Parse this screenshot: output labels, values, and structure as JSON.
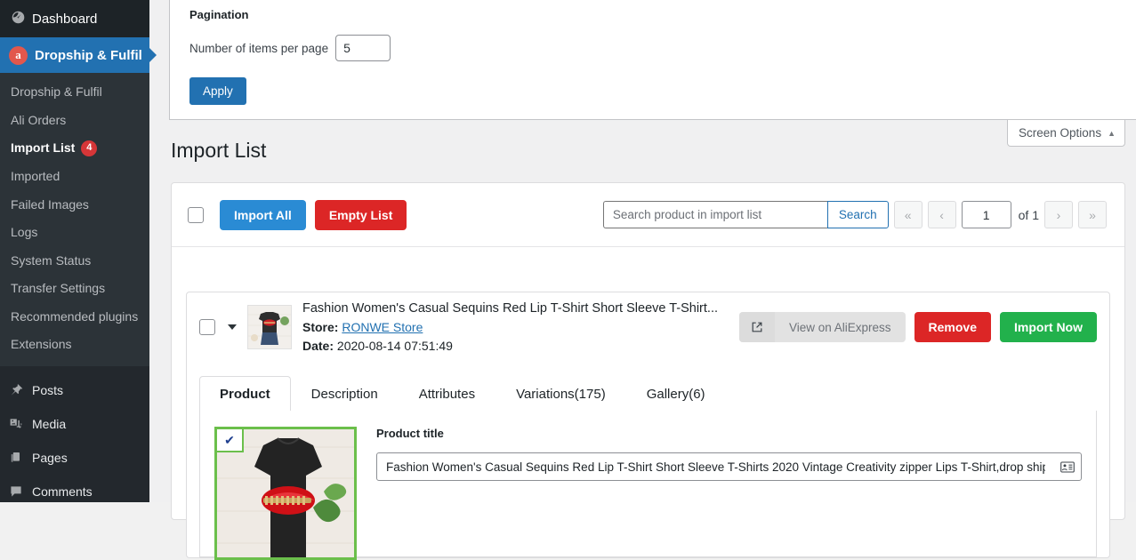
{
  "sidebar": {
    "dashboard": {
      "label": "Dashboard",
      "icon": "dashboard-icon"
    },
    "active_menu": {
      "label": "Dropship & Fulfil",
      "icon": "aliexpress-a-icon"
    },
    "submenu": [
      {
        "label": "Dropship & Fulfil",
        "current": false
      },
      {
        "label": "Ali Orders",
        "current": false
      },
      {
        "label": "Import List",
        "current": true,
        "count": "4"
      },
      {
        "label": "Imported",
        "current": false
      },
      {
        "label": "Failed Images",
        "current": false
      },
      {
        "label": "Logs",
        "current": false
      },
      {
        "label": "System Status",
        "current": false
      },
      {
        "label": "Transfer Settings",
        "current": false
      },
      {
        "label": "Recommended plugins",
        "current": false
      },
      {
        "label": "Extensions",
        "current": false
      }
    ],
    "items": [
      {
        "label": "Posts",
        "icon": "pin-icon"
      },
      {
        "label": "Media",
        "icon": "media-icon"
      },
      {
        "label": "Pages",
        "icon": "pages-icon"
      },
      {
        "label": "Comments",
        "icon": "comment-icon"
      }
    ]
  },
  "screen_options": {
    "tab_label": "Screen Options",
    "tab_caret": "▲",
    "section_title": "Pagination",
    "items_per_page_label": "Number of items per page",
    "items_per_page_value": "5",
    "apply_label": "Apply"
  },
  "page": {
    "title": "Import List"
  },
  "toolbar": {
    "import_all_label": "Import All",
    "empty_list_label": "Empty List",
    "search_placeholder": "Search product in import list",
    "search_value": "",
    "search_button_label": "Search",
    "first_page_label": "«",
    "prev_page_label": "‹",
    "page_number": "1",
    "of_label": "of 1",
    "next_page_label": "›",
    "last_page_label": "»"
  },
  "product": {
    "name": "Fashion Women's Casual Sequins Red Lip T-Shirt Short Sleeve T-Shirt...",
    "store_label": "Store:",
    "store_name": "RONWE Store",
    "date_label": "Date:",
    "date_value": "2020-08-14 07:51:49",
    "view_on_aliexpress_label": "View on AliExpress",
    "remove_label": "Remove",
    "import_now_label": "Import Now",
    "tabs": [
      {
        "label": "Product",
        "active": true
      },
      {
        "label": "Description",
        "active": false
      },
      {
        "label": "Attributes",
        "active": false
      },
      {
        "label": "Variations(175)",
        "active": false
      },
      {
        "label": "Gallery(6)",
        "active": false
      }
    ],
    "title_field_label": "Product title",
    "title_field_value": "Fashion Women's Casual Sequins Red Lip T-Shirt Short Sleeve T-Shirts 2020 Vintage Creativity zipper Lips T-Shirt,drop ship",
    "image_selected_check": "✔"
  },
  "colors": {
    "sidebar_bg": "#23282d",
    "sidebar_submenu_bg": "#2c3338",
    "active_menu_blue": "#2271b1",
    "badge_red": "#d63638",
    "primary_blue": "#2a8bd4",
    "danger_red": "#dc2626",
    "success_green": "#22b14c",
    "image_border_green": "#6bbf4b",
    "canvas_bg": "#f0f0f1"
  }
}
